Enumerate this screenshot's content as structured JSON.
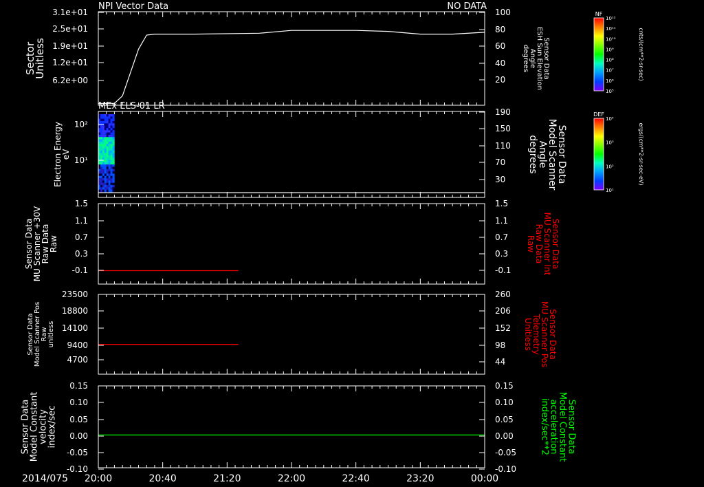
{
  "date_label": "2014/075",
  "x_ticks": [
    "20:00",
    "20:40",
    "21:20",
    "22:00",
    "22:40",
    "23:20",
    "00:00"
  ],
  "colors": {
    "background": "#000000",
    "foreground": "#ffffff",
    "red": "#ff0000",
    "green": "#00ff00"
  },
  "colorbars": [
    {
      "title": "NF",
      "unit": "cnts/(cm**2-sr-sec)",
      "ticks": [
        "10¹²",
        "10¹¹",
        "10¹⁰",
        "10⁹",
        "10⁸",
        "10⁷",
        "10⁶",
        "10⁵"
      ]
    },
    {
      "title": "DEF",
      "unit": "ergs/(cm**2-sr-sec-eV)",
      "ticks": [
        "10⁴",
        "10³",
        "10²",
        "10¹"
      ]
    }
  ],
  "panels": [
    {
      "title_left": "NPI Vector Data",
      "title_right": "NO DATA",
      "ylabel_left": [
        "Sector",
        "Unitless"
      ],
      "left_ticks": [
        "3.1e+01",
        "2.5e+01",
        "1.9e+01",
        "1.2e+01",
        "6.2e+00"
      ],
      "ylabel_right": [
        "Sensor Data",
        "ESH Sun Elevation",
        "Angle",
        "degrees"
      ],
      "right_ticks": [
        "100",
        "80",
        "60",
        "40",
        "20"
      ]
    },
    {
      "title_left": "MEx ELS-01 LR",
      "ylabel_left": [
        "Electron Energy",
        "eV"
      ],
      "left_ticks": [
        "10²",
        "10¹"
      ],
      "ylabel_right": [
        "Sensor Data",
        "Model Scanner",
        "Angle",
        "degrees"
      ],
      "right_ticks": [
        "190",
        "150",
        "110",
        "70",
        "30"
      ]
    },
    {
      "ylabel_left": [
        "Sensor Data",
        "MU Scanner +30V",
        "Raw Data",
        "Raw"
      ],
      "left_ticks": [
        "1.5",
        "1.1",
        "0.7",
        "0.3",
        "-0.1"
      ],
      "ylabel_right": [
        "Sensor Data",
        "MU Scanner Int",
        "Raw Data",
        "Raw"
      ],
      "right_ticks": [
        "1.5",
        "1.1",
        "0.7",
        "0.3",
        "-0.1"
      ]
    },
    {
      "ylabel_left": [
        "Sensor Data",
        "Model Scanner Pos",
        "Raw",
        "unitless"
      ],
      "left_ticks": [
        "23500",
        "18800",
        "14100",
        "9400",
        "4700"
      ],
      "ylabel_right": [
        "Sensor Data",
        "MU Scanner Pos",
        "Telemetry",
        "Unitless"
      ],
      "right_ticks": [
        "260",
        "206",
        "152",
        "98",
        "44"
      ]
    },
    {
      "ylabel_left": [
        "Sensor Data",
        "Model Constant",
        "velocity",
        "index/sec"
      ],
      "left_ticks": [
        "0.15",
        "0.10",
        "0.05",
        "0.00",
        "-0.05",
        "-0.10"
      ],
      "ylabel_right": [
        "Sensor Data",
        "Model Constant",
        "acceleration",
        "index/sec**2"
      ],
      "right_ticks": [
        "0.15",
        "0.10",
        "0.05",
        "0.00",
        "-0.05",
        "-0.10"
      ]
    }
  ],
  "chart_data": [
    {
      "type": "line",
      "panel": 0,
      "color": "#ffffff",
      "ylim": [
        0,
        100
      ],
      "x": [
        "20:00",
        "20:10",
        "20:15",
        "20:20",
        "20:25",
        "20:30",
        "20:35",
        "20:40",
        "21:00",
        "21:40",
        "22:00",
        "22:40",
        "23:00",
        "23:20",
        "23:40",
        "00:00"
      ],
      "values": [
        2,
        2,
        10,
        35,
        60,
        75,
        76,
        76,
        76,
        77,
        80,
        80,
        79,
        76,
        76,
        78
      ]
    },
    {
      "type": "heatmap",
      "panel": 1,
      "ylog": true,
      "ylim": [
        2,
        200
      ],
      "color_scale": "DEF",
      "x_range": [
        "20:00",
        "20:10"
      ],
      "y_range": [
        2,
        200
      ]
    },
    {
      "type": "line",
      "panel": 1,
      "color": "#ffffff",
      "ylim": [
        10,
        190
      ],
      "x": [
        "20:00",
        "00:00"
      ],
      "values": [
        20,
        20
      ]
    },
    {
      "type": "line",
      "panel": 2,
      "color": "#ff0000",
      "ylim": [
        -0.3,
        1.5
      ],
      "x": [
        "20:00",
        "21:27"
      ],
      "values": [
        0.0,
        0.0
      ]
    },
    {
      "type": "line",
      "panel": 3,
      "color": "#ff0000",
      "ylim": [
        0,
        23500
      ],
      "x": [
        "20:00",
        "21:27"
      ],
      "values": [
        8800,
        8800
      ]
    },
    {
      "type": "line",
      "panel": 4,
      "color": "#00ff00",
      "ylim": [
        -0.1,
        0.15
      ],
      "x": [
        "20:00",
        "00:00"
      ],
      "values": [
        0.0,
        0.0
      ]
    }
  ]
}
